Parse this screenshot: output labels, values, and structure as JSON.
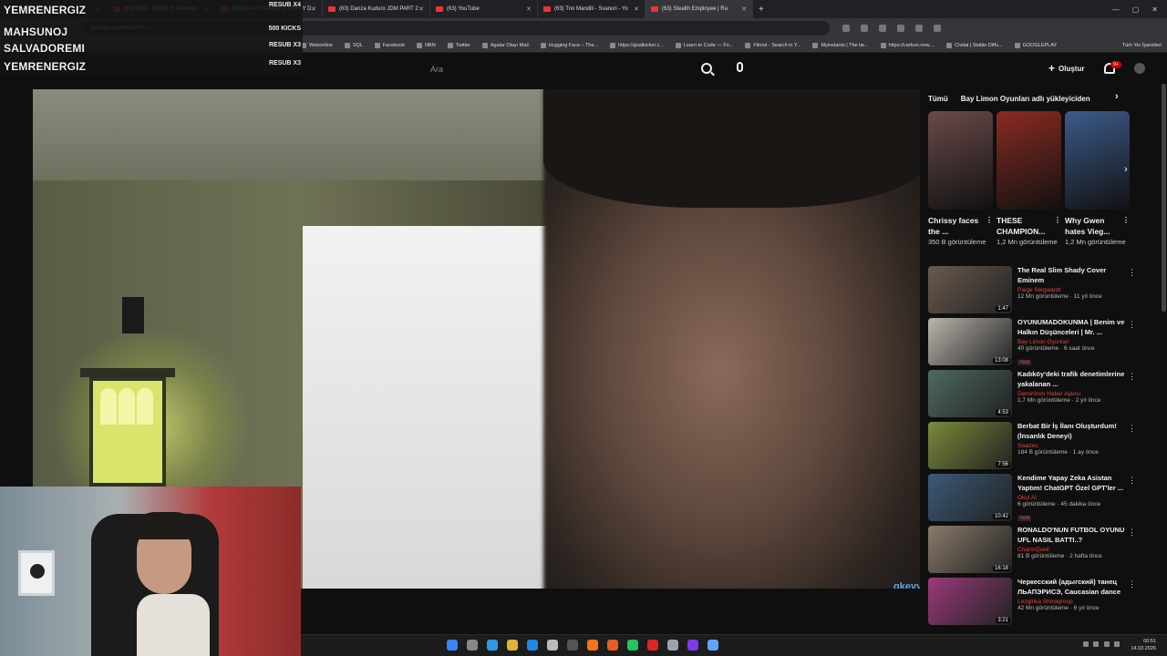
{
  "browser": {
    "tabs": [
      {
        "label": "fficial Re"
      },
      {
        "label": "(63) K/DA - MORE ft. Madison"
      },
      {
        "label": "(63) CIA VS TANRI(?): TERRY D."
      },
      {
        "label": "(63) Danza Kuduro JDM PART 2"
      },
      {
        "label": "(63) YouTube"
      },
      {
        "label": "(63) Trio Mandili - Svanuri - Yo"
      },
      {
        "label": "(63) Stealth Employee | Ra"
      }
    ],
    "url": "youtube.com/watch?v=...",
    "bookmarks": [
      "Webonline",
      "SQL",
      "Facebook",
      "NBN",
      "Twitter",
      "Agalar Olayı Mail",
      "Hugging Face – The...",
      "https://goalkicker.c...",
      "Learn to Code — Fo...",
      "Filmot - Search in Y...",
      "Myinstants | The lar...",
      "https://carbon.now....",
      "Civitai | Stable Diffu...",
      "GOOGLEPLAY"
    ],
    "bookmarks_all": "Tüm Yer İşaretleri"
  },
  "overlay": {
    "rows": [
      {
        "name": "YEMRENERGIZ",
        "tag": "RESUB X4"
      },
      {
        "name": "MAHSUNOJ",
        "tag": "500 KICKS"
      },
      {
        "name": "SALVADOREMI",
        "tag": "RESUB X3"
      },
      {
        "name": "YEMRENERGIZ",
        "tag": "RESUB X3"
      }
    ]
  },
  "youtube": {
    "search_placeholder": "Ara",
    "create_label": "Oluştur",
    "notif_count": "9+"
  },
  "video": {
    "watermark": "gkeyy"
  },
  "sidebar": {
    "chips": [
      "Tümü",
      "Bay Limon Oyunları adlı yükleyiciden"
    ],
    "shorts": [
      {
        "title": "Chrissy faces the ...",
        "views": "350 B görüntüleme",
        "color": "#6a4a4a"
      },
      {
        "title": "THESE CHAMPION...",
        "views": "1,2 Mn görüntüleme",
        "color": "#8a2b22"
      },
      {
        "title": "Why Gwen hates Vieg...",
        "views": "1,2 Mn görüntüleme",
        "color": "#3d5b8a"
      }
    ],
    "recommendations": [
      {
        "title": "The Real Slim Shady Cover Eminem",
        "channel": "Paige Slegwardt",
        "meta": "12 Mn görüntüleme · 11 yıl önce",
        "duration": "1:47",
        "new": "",
        "color": "#6b5a4e"
      },
      {
        "title": "OYUNUMADOKUNMA | Benim ve Halkın Düşünceleri | Mr. ...",
        "channel": "Bay Limon Oyunları",
        "meta": "40 görüntüleme · 6 saat önce",
        "duration": "13:08",
        "new": "Yeni",
        "color": "#b9b4ad"
      },
      {
        "title": "Kadıköy'deki trafik denetimlerine yakalanan ...",
        "channel": "Demirören Haber Ajansı",
        "meta": "1,7 Mn görüntüleme · 2 yıl önce",
        "duration": "4:53",
        "new": "",
        "color": "#4e6a5e"
      },
      {
        "title": "Berbat Bir İş İlanı Oluşturdum! (İnsanlık Deneyi)",
        "channel": "Swazes",
        "meta": "184 B görüntüleme · 1 ay önce",
        "duration": "7:56",
        "new": "",
        "color": "#7a8a3a"
      },
      {
        "title": "Kendime Yapay Zeka Asistan Yaptım! ChatGPT Özel GPT'ler ...",
        "channel": "Okul AI",
        "meta": "6 görüntüleme · 45 dakika önce",
        "duration": "10:42",
        "new": "Yeni",
        "color": "#3b5a78"
      },
      {
        "title": "RONALDO'NUN FUTBOL OYUNU UFL NASIL BATTI..?",
        "channel": "CharmQuell",
        "meta": "81 B görüntüleme · 2 hafta önce",
        "duration": "16:18",
        "new": "",
        "color": "#8a7a6a"
      },
      {
        "title": "Черкесский (адыгский) танец ЛЬАПЭРИСЭ, Caucasian dance",
        "channel": "Lezginka Showgroup",
        "meta": "42 Mn görüntüleme · 6 yıl önce",
        "duration": "3:21",
        "new": "",
        "color": "#9a3a7a"
      }
    ]
  },
  "taskbar": {
    "time": "00:51",
    "date": "14.03.2026",
    "icons": [
      "#3b82f6",
      "#888888",
      "#2b9be8",
      "#e0b23a",
      "#1e88e5",
      "#bbbbbb",
      "#555555",
      "#f97316",
      "#e85d24",
      "#22c55e",
      "#dc2626",
      "#9ca3af",
      "#7c3aed",
      "#60a5fa"
    ]
  }
}
